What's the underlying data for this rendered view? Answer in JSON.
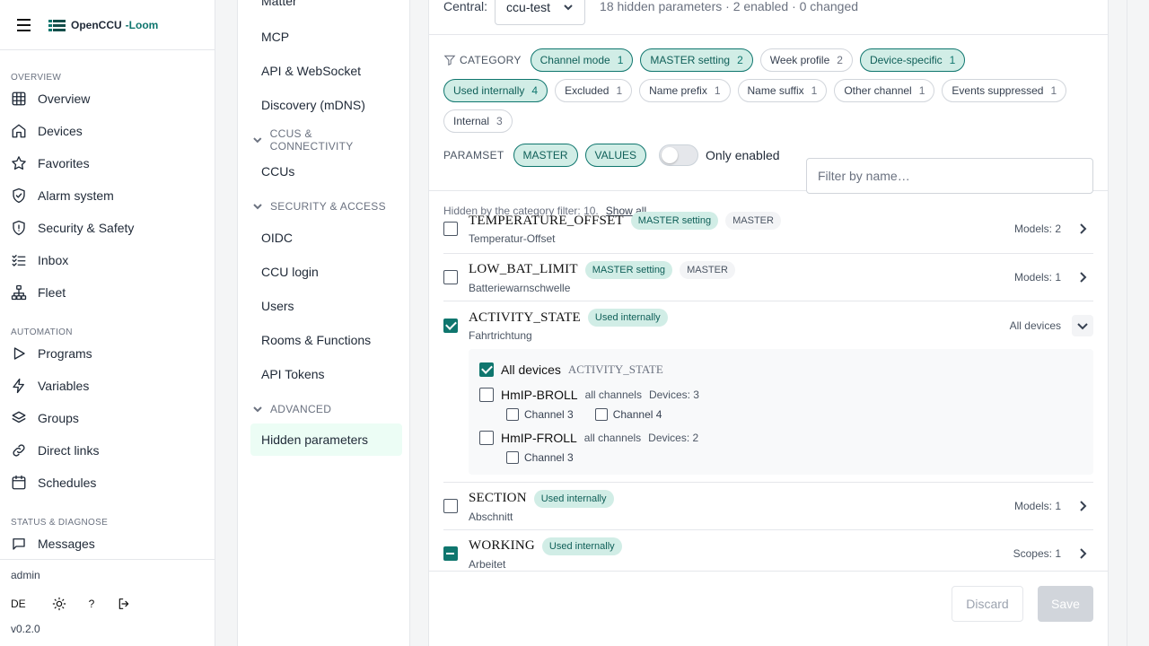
{
  "app": {
    "name": "OpenCCU",
    "suffix": "-Loom"
  },
  "sidebar": {
    "sections": [
      {
        "label": "OVERVIEW",
        "items": [
          {
            "label": "Overview",
            "icon": "grid-icon"
          },
          {
            "label": "Devices",
            "icon": "home-icon"
          },
          {
            "label": "Favorites",
            "icon": "star-icon"
          },
          {
            "label": "Alarm system",
            "icon": "shield-check-icon"
          },
          {
            "label": "Security & Safety",
            "icon": "shield-alert-icon"
          },
          {
            "label": "Inbox",
            "icon": "list-check-icon"
          },
          {
            "label": "Fleet",
            "icon": "network-icon"
          }
        ]
      },
      {
        "label": "AUTOMATION",
        "items": [
          {
            "label": "Programs",
            "icon": "play-icon"
          },
          {
            "label": "Variables",
            "icon": "bolt-icon"
          },
          {
            "label": "Groups",
            "icon": "layers-icon"
          },
          {
            "label": "Direct links",
            "icon": "link-icon"
          },
          {
            "label": "Schedules",
            "icon": "calendar-icon"
          }
        ]
      },
      {
        "label": "STATUS & DIAGNOSE",
        "items": [
          {
            "label": "Messages",
            "icon": "message-icon"
          }
        ]
      }
    ],
    "user": "admin",
    "lang": "DE",
    "help": "?",
    "version": "v0.2.0"
  },
  "subnav": {
    "top_items": [
      "Matter",
      "MCP",
      "API & WebSocket",
      "Discovery (mDNS)"
    ],
    "groups": [
      {
        "label": "CCUS & CONNECTIVITY",
        "items": [
          "CCUs"
        ]
      },
      {
        "label": "SECURITY & ACCESS",
        "items": [
          "OIDC",
          "CCU login",
          "Users",
          "Rooms & Functions",
          "API Tokens"
        ]
      },
      {
        "label": "ADVANCED",
        "items": [
          "Hidden parameters"
        ]
      }
    ]
  },
  "main": {
    "central_label": "Central:",
    "central_value": "ccu-test",
    "summary": "18 hidden parameters · 2 enabled · 0 changed",
    "category_label": "CATEGORY",
    "categories": [
      {
        "label": "Channel mode",
        "count": "1",
        "on": true
      },
      {
        "label": "MASTER setting",
        "count": "2",
        "on": true
      },
      {
        "label": "Week profile",
        "count": "2",
        "on": false
      },
      {
        "label": "Device-specific",
        "count": "1",
        "on": true
      },
      {
        "label": "Used internally",
        "count": "4",
        "on": true
      },
      {
        "label": "Excluded",
        "count": "1",
        "on": false
      },
      {
        "label": "Name prefix",
        "count": "1",
        "on": false
      },
      {
        "label": "Name suffix",
        "count": "1",
        "on": false
      },
      {
        "label": "Other channel",
        "count": "1",
        "on": false
      },
      {
        "label": "Events suppressed",
        "count": "1",
        "on": false
      },
      {
        "label": "Internal",
        "count": "3",
        "on": false
      }
    ],
    "paramset_label": "PARAMSET",
    "paramsets": [
      "MASTER",
      "VALUES"
    ],
    "only_enabled_label": "Only enabled",
    "filter_placeholder": "Filter by name…",
    "hidden_note": "Hidden by the category filter: 10.",
    "show_all": "Show all",
    "params": [
      {
        "name": "TEMPERATURE_OFFSET",
        "tags": [
          "MASTER setting",
          "MASTER"
        ],
        "sub": "Temperatur-Offset",
        "meta": "Models: 2",
        "state": "unchecked"
      },
      {
        "name": "LOW_BAT_LIMIT",
        "tags": [
          "MASTER setting",
          "MASTER"
        ],
        "sub": "Batteriewarnschwelle",
        "meta": "Models: 1",
        "state": "unchecked"
      },
      {
        "name": "ACTIVITY_STATE",
        "tags": [
          "Used internally"
        ],
        "sub": "Fahrtrichtung",
        "meta": "All devices",
        "state": "checked"
      },
      {
        "name": "SECTION",
        "tags": [
          "Used internally"
        ],
        "sub": "Abschnitt",
        "meta": "Models: 1",
        "state": "unchecked"
      },
      {
        "name": "WORKING",
        "tags": [
          "Used internally"
        ],
        "sub": "Arbeitet",
        "meta": "Scopes: 1",
        "state": "mixed"
      }
    ],
    "expanded": {
      "all_devices_label": "All devices",
      "all_devices_param": "ACTIVITY_STATE",
      "models": [
        {
          "name": "HmIP-BROLL",
          "scope": "all channels",
          "devices": "Devices: 3",
          "channels": [
            "Channel 3",
            "Channel 4"
          ]
        },
        {
          "name": "HmIP-FROLL",
          "scope": "all channels",
          "devices": "Devices: 2",
          "channels": [
            "Channel 3"
          ]
        }
      ]
    },
    "discard_label": "Discard",
    "save_label": "Save"
  }
}
